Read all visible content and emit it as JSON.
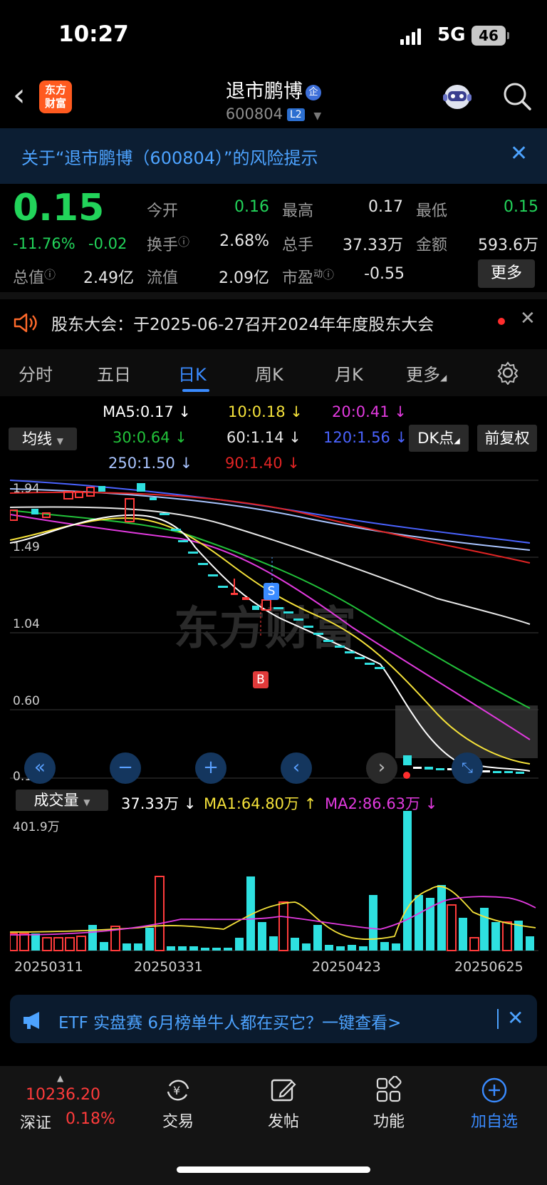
{
  "status_bar": {
    "time": "10:27",
    "network": "5G",
    "battery": "46"
  },
  "header": {
    "logo_line1": "东方",
    "logo_line2": "财富",
    "stock_name": "退市鹏博",
    "badge": "企",
    "stock_code": "600804",
    "level_badge": "L2"
  },
  "risk_banner": {
    "text": "关于“退市鹏博（600804）”的风险提示"
  },
  "quote": {
    "price": "0.15",
    "change_pct": "-11.76%",
    "change": "-0.02",
    "open_label": "今开",
    "open": "0.16",
    "high_label": "最高",
    "high": "0.17",
    "low_label": "最低",
    "low": "0.15",
    "turnover_label": "换手",
    "turnover": "2.68%",
    "volume_label": "总手",
    "volume": "37.33万",
    "amount_label": "金额",
    "amount": "593.6万",
    "mktcap_label": "总值",
    "mktcap": "2.49亿",
    "float_label": "流值",
    "float": "2.09亿",
    "pe_label": "市盈",
    "pe_sup": "动",
    "pe": "-0.55",
    "more_button": "更多"
  },
  "notice": {
    "text": "股东大会：于2025-06-27召开2024年年度股东大会"
  },
  "tabs": [
    "分时",
    "五日",
    "日K",
    "周K",
    "月K",
    "更多"
  ],
  "selected_tab": "日K",
  "ma": {
    "selector": "均线",
    "items": [
      {
        "label": "MA5:0.17",
        "color": "#ffffff"
      },
      {
        "label": "10:0.18",
        "color": "#f5e23a"
      },
      {
        "label": "20:0.41",
        "color": "#e23adf"
      },
      {
        "label": "30:0.64",
        "color": "#22c23a"
      },
      {
        "label": "60:1.14",
        "color": "#e6e6e6"
      },
      {
        "label": "120:1.56",
        "color": "#4a63ff"
      },
      {
        "label": "250:1.50",
        "color": "#a9c4ff"
      },
      {
        "label": "90:1.40",
        "color": "#e02424"
      }
    ],
    "dk_button": "DK点",
    "adjust_button": "前复权"
  },
  "price_axis": [
    "1.94",
    "1.49",
    "1.04",
    "0.60",
    "0.15"
  ],
  "markers": {
    "sell": "S",
    "buy": "B"
  },
  "volume": {
    "selector": "成交量",
    "current": "37.33万",
    "ma1": "MA1:64.80万",
    "ma2": "MA2:86.63万",
    "max_label": "401.9万"
  },
  "dates": [
    "20250311",
    "20250331",
    "20250423",
    "20250625"
  ],
  "chart_data": {
    "type": "candlestick",
    "ylim": [
      0.15,
      1.94
    ],
    "last_close": 0.15,
    "ma_lines": [
      "MA5",
      "MA10",
      "MA20",
      "MA30",
      "MA60",
      "MA120",
      "MA250",
      "MA90"
    ],
    "volume_max": "401.9万"
  },
  "etf_banner": {
    "text": "ETF 实盘赛 6月榜单牛人都在买它？一键查看>"
  },
  "bottom_bar": {
    "index_value": "10236.20",
    "index_name": "深证",
    "index_pct": "0.18%",
    "items": [
      "交易",
      "发帖",
      "功能",
      "加自选"
    ]
  }
}
